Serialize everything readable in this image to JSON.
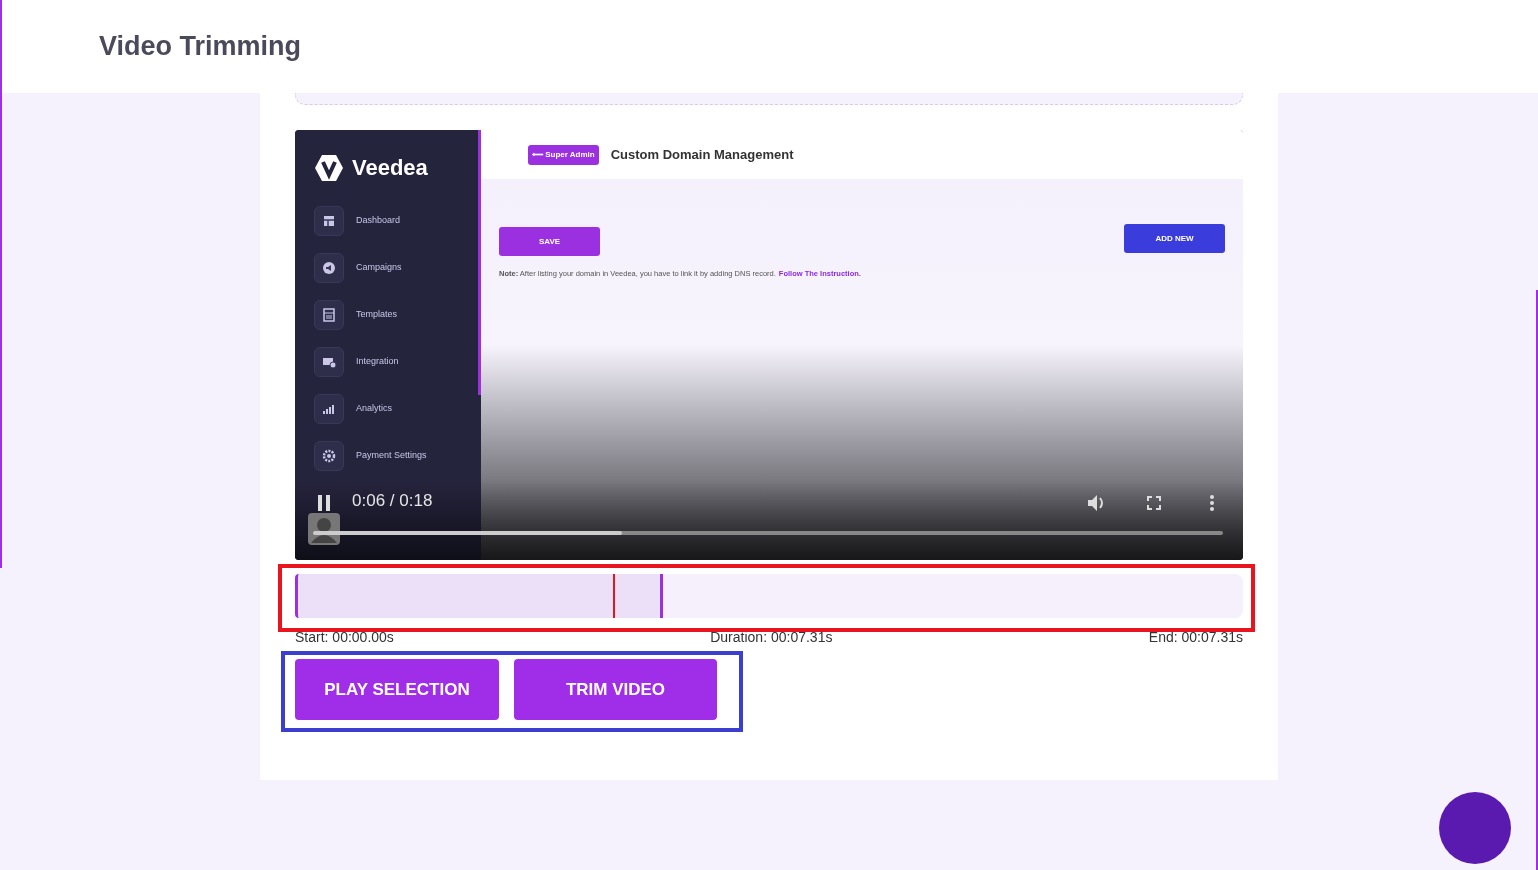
{
  "header": {
    "title": "Video Trimming"
  },
  "video": {
    "app": {
      "logo": "Veedea",
      "nav": [
        {
          "label": "Dashboard"
        },
        {
          "label": "Campaigns"
        },
        {
          "label": "Templates"
        },
        {
          "label": "Integration"
        },
        {
          "label": "Analytics"
        },
        {
          "label": "Payment Settings"
        }
      ],
      "badge": "⟵ Super Admin",
      "title": "Custom Domain Management",
      "save_button": "SAVE",
      "add_button": "ADD NEW",
      "note": "**Note:** After listing your domain in Veedea, you have to link it by adding DNS record.",
      "note_link": "Follow The Instruction."
    },
    "player": {
      "time": "0:06 / 0:18",
      "level": 0.34
    }
  },
  "timeline": {
    "selection": {
      "level": 0.388
    },
    "playhead": {
      "level": 0.335
    },
    "labels": {
      "start": "Start: 00:00.00s",
      "duration": "Duration: 00:07.31s",
      "end": "End: 00:07.31s"
    }
  },
  "buttons": [
    "PLAY SELECTION",
    "TRIM VIDEO"
  ]
}
